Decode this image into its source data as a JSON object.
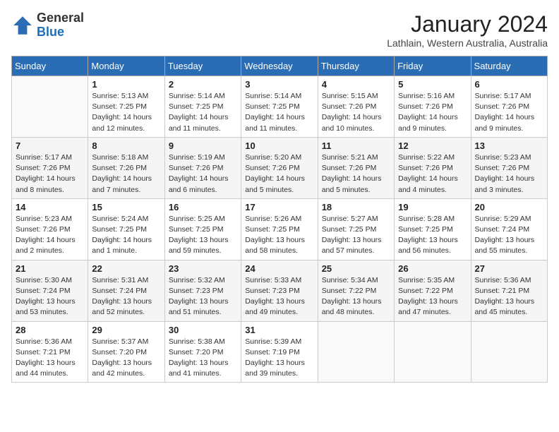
{
  "header": {
    "logo_line1": "General",
    "logo_line2": "Blue",
    "month": "January 2024",
    "location": "Lathlain, Western Australia, Australia"
  },
  "weekdays": [
    "Sunday",
    "Monday",
    "Tuesday",
    "Wednesday",
    "Thursday",
    "Friday",
    "Saturday"
  ],
  "weeks": [
    [
      {
        "day": "",
        "info": ""
      },
      {
        "day": "1",
        "info": "Sunrise: 5:13 AM\nSunset: 7:25 PM\nDaylight: 14 hours\nand 12 minutes."
      },
      {
        "day": "2",
        "info": "Sunrise: 5:14 AM\nSunset: 7:25 PM\nDaylight: 14 hours\nand 11 minutes."
      },
      {
        "day": "3",
        "info": "Sunrise: 5:14 AM\nSunset: 7:25 PM\nDaylight: 14 hours\nand 11 minutes."
      },
      {
        "day": "4",
        "info": "Sunrise: 5:15 AM\nSunset: 7:26 PM\nDaylight: 14 hours\nand 10 minutes."
      },
      {
        "day": "5",
        "info": "Sunrise: 5:16 AM\nSunset: 7:26 PM\nDaylight: 14 hours\nand 9 minutes."
      },
      {
        "day": "6",
        "info": "Sunrise: 5:17 AM\nSunset: 7:26 PM\nDaylight: 14 hours\nand 9 minutes."
      }
    ],
    [
      {
        "day": "7",
        "info": "Sunrise: 5:17 AM\nSunset: 7:26 PM\nDaylight: 14 hours\nand 8 minutes."
      },
      {
        "day": "8",
        "info": "Sunrise: 5:18 AM\nSunset: 7:26 PM\nDaylight: 14 hours\nand 7 minutes."
      },
      {
        "day": "9",
        "info": "Sunrise: 5:19 AM\nSunset: 7:26 PM\nDaylight: 14 hours\nand 6 minutes."
      },
      {
        "day": "10",
        "info": "Sunrise: 5:20 AM\nSunset: 7:26 PM\nDaylight: 14 hours\nand 5 minutes."
      },
      {
        "day": "11",
        "info": "Sunrise: 5:21 AM\nSunset: 7:26 PM\nDaylight: 14 hours\nand 5 minutes."
      },
      {
        "day": "12",
        "info": "Sunrise: 5:22 AM\nSunset: 7:26 PM\nDaylight: 14 hours\nand 4 minutes."
      },
      {
        "day": "13",
        "info": "Sunrise: 5:23 AM\nSunset: 7:26 PM\nDaylight: 14 hours\nand 3 minutes."
      }
    ],
    [
      {
        "day": "14",
        "info": "Sunrise: 5:23 AM\nSunset: 7:26 PM\nDaylight: 14 hours\nand 2 minutes."
      },
      {
        "day": "15",
        "info": "Sunrise: 5:24 AM\nSunset: 7:25 PM\nDaylight: 14 hours\nand 1 minute."
      },
      {
        "day": "16",
        "info": "Sunrise: 5:25 AM\nSunset: 7:25 PM\nDaylight: 13 hours\nand 59 minutes."
      },
      {
        "day": "17",
        "info": "Sunrise: 5:26 AM\nSunset: 7:25 PM\nDaylight: 13 hours\nand 58 minutes."
      },
      {
        "day": "18",
        "info": "Sunrise: 5:27 AM\nSunset: 7:25 PM\nDaylight: 13 hours\nand 57 minutes."
      },
      {
        "day": "19",
        "info": "Sunrise: 5:28 AM\nSunset: 7:25 PM\nDaylight: 13 hours\nand 56 minutes."
      },
      {
        "day": "20",
        "info": "Sunrise: 5:29 AM\nSunset: 7:24 PM\nDaylight: 13 hours\nand 55 minutes."
      }
    ],
    [
      {
        "day": "21",
        "info": "Sunrise: 5:30 AM\nSunset: 7:24 PM\nDaylight: 13 hours\nand 53 minutes."
      },
      {
        "day": "22",
        "info": "Sunrise: 5:31 AM\nSunset: 7:24 PM\nDaylight: 13 hours\nand 52 minutes."
      },
      {
        "day": "23",
        "info": "Sunrise: 5:32 AM\nSunset: 7:23 PM\nDaylight: 13 hours\nand 51 minutes."
      },
      {
        "day": "24",
        "info": "Sunrise: 5:33 AM\nSunset: 7:23 PM\nDaylight: 13 hours\nand 49 minutes."
      },
      {
        "day": "25",
        "info": "Sunrise: 5:34 AM\nSunset: 7:22 PM\nDaylight: 13 hours\nand 48 minutes."
      },
      {
        "day": "26",
        "info": "Sunrise: 5:35 AM\nSunset: 7:22 PM\nDaylight: 13 hours\nand 47 minutes."
      },
      {
        "day": "27",
        "info": "Sunrise: 5:36 AM\nSunset: 7:21 PM\nDaylight: 13 hours\nand 45 minutes."
      }
    ],
    [
      {
        "day": "28",
        "info": "Sunrise: 5:36 AM\nSunset: 7:21 PM\nDaylight: 13 hours\nand 44 minutes."
      },
      {
        "day": "29",
        "info": "Sunrise: 5:37 AM\nSunset: 7:20 PM\nDaylight: 13 hours\nand 42 minutes."
      },
      {
        "day": "30",
        "info": "Sunrise: 5:38 AM\nSunset: 7:20 PM\nDaylight: 13 hours\nand 41 minutes."
      },
      {
        "day": "31",
        "info": "Sunrise: 5:39 AM\nSunset: 7:19 PM\nDaylight: 13 hours\nand 39 minutes."
      },
      {
        "day": "",
        "info": ""
      },
      {
        "day": "",
        "info": ""
      },
      {
        "day": "",
        "info": ""
      }
    ]
  ]
}
